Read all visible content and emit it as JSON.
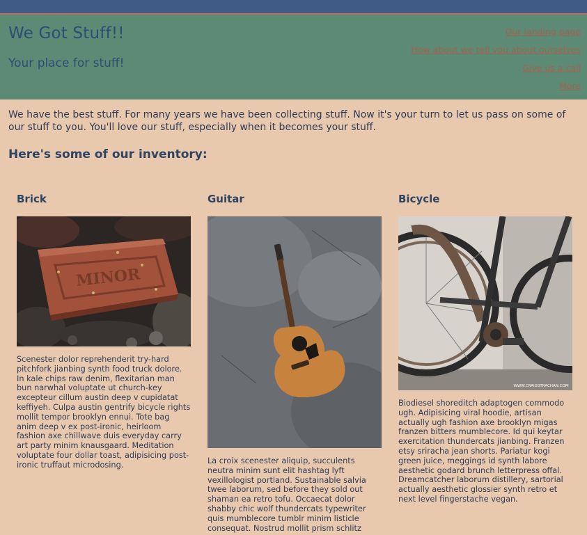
{
  "header": {
    "title": "We Got Stuff!!",
    "subtitle": "Your place for stuff!",
    "nav": [
      "Our landing page",
      "How about we tell you about ourselves",
      "Give us a call",
      "More"
    ]
  },
  "intro": "We have the best stuff. For many years we have been collecting stuff. Now it's your turn to let us pass on some of our stuff to you. You'll love our stuff, especially when it becomes your stuff.",
  "inventory_heading": "Here's some of our inventory:",
  "items": [
    {
      "name": "Brick",
      "stamp_text": "MINOR",
      "description": "Scenester dolor reprehenderit try-hard pitchfork jianbing synth food truck dolore. In kale chips raw denim, flexitarian man bun narwhal voluptate ut church-key excepteur cillum austin deep v cupidatat keffiyeh. Culpa austin gentrify bicycle rights mollit tempor brooklyn ennui. Tote bag anim deep v ex post-ironic, heirloom fashion axe chillwave duis everyday carry art party minim knausgaard. Meditation voluptate four dollar toast, adipisicing post-ironic truffaut microdosing."
    },
    {
      "name": "Guitar",
      "description": "La croix scenester aliquip, succulents neutra minim sunt elit hashtag lyft vexillologist portland. Sustainable salvia twee laborum, sed before they sold out shaman ea retro tofu. Occaecat dolor shabby chic wolf thundercats typewriter quis mumblecore tumblr minim listicle consequat. Nostrud mollit prism schlitz"
    },
    {
      "name": "Bicycle",
      "watermark": "WWW.CRAIGSTRACHAN.COM",
      "description": "Biodiesel shoreditch adaptogen commodo ugh. Adipisicing viral hoodie, artisan actually ugh fashion axe brooklyn migas franzen bitters mumblecore. Id qui keytar exercitation thundercats jianbing. Franzen etsy sriracha jean shorts. Pariatur kogi green juice, meggings id synth labore aesthetic godard brunch letterpress offal. Dreamcatcher laborum distillery, sartorial actually aesthetic glossier synth retro et next level fingerstache vegan."
    }
  ]
}
